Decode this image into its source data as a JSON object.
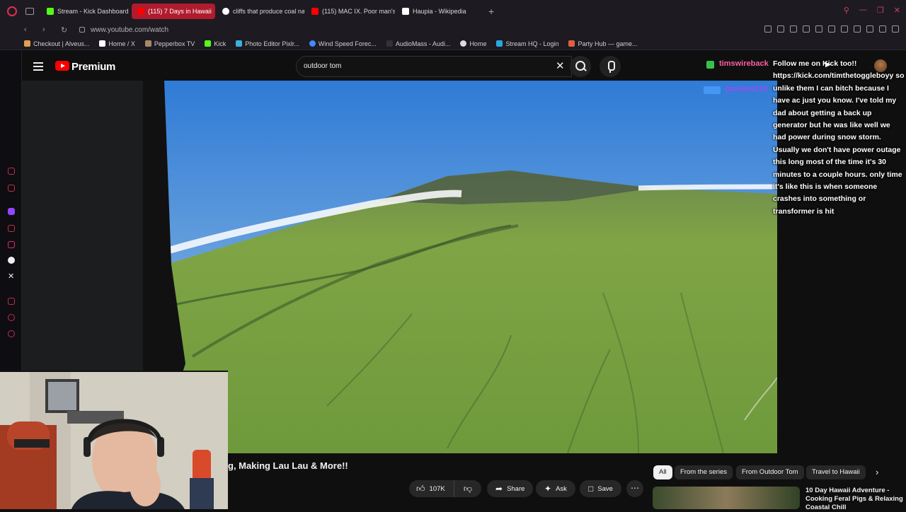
{
  "browser": {
    "tabs": [
      {
        "label": "Stream - Kick Dashboard",
        "color": "#53fc18",
        "active": false
      },
      {
        "label": "(115) 7 Days in Hawaii",
        "color": "#ff0000",
        "active": true
      },
      {
        "label": "cliffs that produce coal nat",
        "color": "#ffffff",
        "active": false
      },
      {
        "label": "(115) MAC IX. Poor man's h",
        "color": "#ff0000",
        "active": false
      },
      {
        "label": "Haupia - Wikipedia",
        "color": "#ffffff",
        "active": false
      }
    ],
    "url": "www.youtube.com/watch",
    "bookmarks": [
      {
        "label": "Checkout | Alveus...",
        "color": "#e0a050"
      },
      {
        "label": "Home / X",
        "color": "#ffffff"
      },
      {
        "label": "Pepperbox TV",
        "color": "#aa8866"
      },
      {
        "label": "Kick",
        "color": "#53fc18"
      },
      {
        "label": "Photo Editor Pixlr...",
        "color": "#3ab0e0"
      },
      {
        "label": "Wind Speed Forec...",
        "color": "#4488ff"
      },
      {
        "label": "AudioMass - Audi...",
        "color": "#333333"
      },
      {
        "label": "Home",
        "color": "#dddddd"
      },
      {
        "label": "Stream HQ - Login",
        "color": "#2aa7e0"
      },
      {
        "label": "Party Hub — game...",
        "color": "#e06040"
      }
    ]
  },
  "youtube": {
    "brand": "Premium",
    "search_value": "outdoor tom",
    "video_title": "g, Making Lau Lau & More!!",
    "actions": {
      "likes": "107K",
      "share": "Share",
      "ask": "Ask",
      "save": "Save"
    },
    "chips": [
      "All",
      "From the series",
      "From Outdoor Tom",
      "Travel to Hawaii"
    ],
    "recommendation_title": "10 Day Hawaii Adventure - Cooking Feral Pigs & Relaxing Coastal Chill"
  },
  "chat": {
    "username": "timswireback",
    "username2": "jacobsa210",
    "message": "Follow me on Kick too!! https://kick.com/timthetoggleboyy so unlike them I can bitch because I have ac just you know. I've told my dad about getting a back up generator but he was like well we had power during snow storm. Usually we don't have power outage this long most of the time it's 30 minutes to a couple hours. only time it's like this is when someone crashes into something or transformer is hit"
  }
}
